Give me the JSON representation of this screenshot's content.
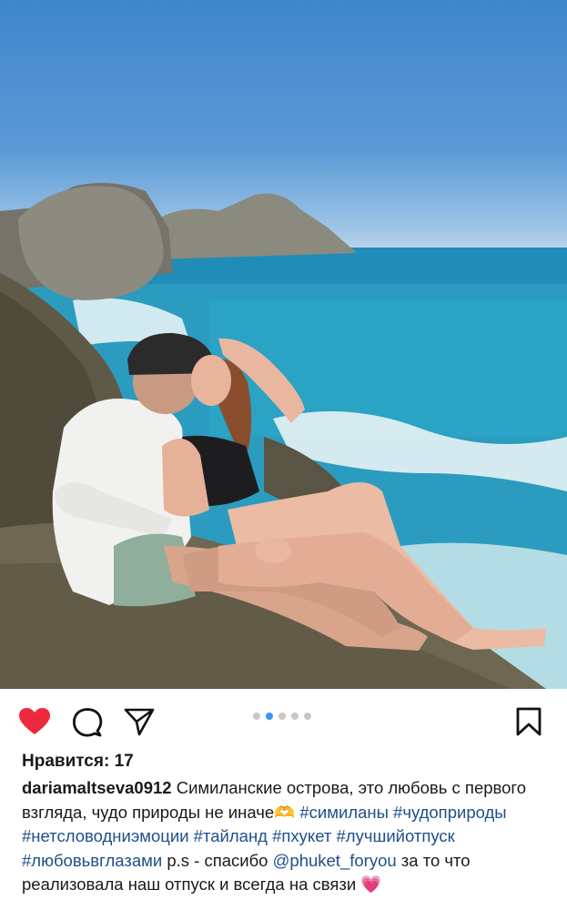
{
  "post": {
    "likes_label": "Нравится: 17",
    "username": "dariamaltseva0912",
    "caption_part1": " Симиланские острова, это любовь с первого взгляда, чудо природы не иначе",
    "emoji_hands": "🫶",
    "hashtags_line1": "#симиланы",
    "hashtags_line2": "#чудоприроды #нетсловодниэмоции #тайланд #пхукет",
    "hashtags_line3": "#лучшийотпуск #любовьвглазами",
    "caption_ps": " p.s - спасибо",
    "mention": "@phuket_foryou",
    "caption_part2": " за то что реализовала наш отпуск и всегда на связи ",
    "emoji_heart": "💗"
  },
  "actions": {
    "like_icon": "heart-filled-icon",
    "comment_icon": "comment-icon",
    "share_icon": "send-icon",
    "save_icon": "bookmark-icon",
    "like_color": "#ed4956"
  },
  "carousel": {
    "count": 5,
    "active_index": 1
  }
}
